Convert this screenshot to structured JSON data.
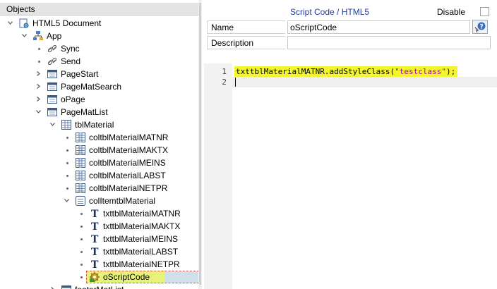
{
  "tree": {
    "header": "Objects",
    "nodes": [
      {
        "label": "HTML5 Document",
        "icon": "document-tree-icon"
      },
      {
        "label": "App",
        "icon": "app-sitemap-icon"
      },
      {
        "label": "Sync",
        "icon": "link-icon"
      },
      {
        "label": "Send",
        "icon": "link-icon"
      },
      {
        "label": "PageStart",
        "icon": "page-icon"
      },
      {
        "label": "PageMatSearch",
        "icon": "page-icon"
      },
      {
        "label": "oPage",
        "icon": "page-icon"
      },
      {
        "label": "PageMatList",
        "icon": "page-icon"
      },
      {
        "label": "tblMaterial",
        "icon": "table-icon"
      },
      {
        "label": "coltblMaterialMATNR",
        "icon": "column-icon"
      },
      {
        "label": "coltblMaterialMAKTX",
        "icon": "column-icon"
      },
      {
        "label": "coltblMaterialMEINS",
        "icon": "column-icon"
      },
      {
        "label": "coltblMaterialLABST",
        "icon": "column-icon"
      },
      {
        "label": "coltblMaterialNETPR",
        "icon": "column-icon"
      },
      {
        "label": "colItemtblMaterial",
        "icon": "column-item-icon"
      },
      {
        "label": "txttblMaterialMATNR",
        "icon": "text-icon"
      },
      {
        "label": "txttblMaterialMAKTX",
        "icon": "text-icon"
      },
      {
        "label": "txttblMaterialMEINS",
        "icon": "text-icon"
      },
      {
        "label": "txttblMaterialLABST",
        "icon": "text-icon"
      },
      {
        "label": "txttblMaterialNETPR",
        "icon": "text-icon"
      },
      {
        "label": "oScriptCode",
        "icon": "script-gear-icon"
      },
      {
        "label": "footerMatList",
        "icon": "page-icon"
      }
    ]
  },
  "properties": {
    "title": "Script Code / HTML5",
    "disable_label": "Disable",
    "disable_checked": false,
    "name_label": "Name",
    "name_value": "oScriptCode",
    "description_label": "Description",
    "description_value": "",
    "help_icon": "help-pointer-icon"
  },
  "editor": {
    "lines": [
      {
        "number": "1",
        "code_plain": "txttblMaterialMATNR.addStyleClass(",
        "code_string": "\"testclass\"",
        "code_end": ");"
      },
      {
        "number": "2",
        "code_plain": "",
        "code_string": "",
        "code_end": ""
      }
    ],
    "highlight_color": "#f5f52f"
  },
  "colors": {
    "title_blue": "#1f3c9e",
    "selection_bg": "#cfe0ea",
    "green_highlight": "#e6f27a"
  }
}
